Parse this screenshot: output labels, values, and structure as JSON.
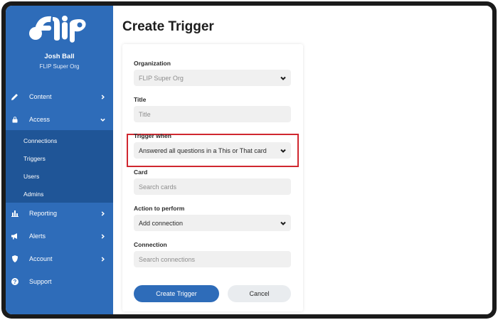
{
  "user": {
    "name": "Josh Ball",
    "org": "FLIP Super Org"
  },
  "logo_text": "FLIP",
  "nav": {
    "content": "Content",
    "access": "Access",
    "access_sub": [
      "Connections",
      "Triggers",
      "Users",
      "Admins"
    ],
    "reporting": "Reporting",
    "alerts": "Alerts",
    "account": "Account",
    "support": "Support"
  },
  "page": {
    "title": "Create Trigger"
  },
  "form": {
    "organization": {
      "label": "Organization",
      "value": "FLIP Super Org"
    },
    "title": {
      "label": "Title",
      "placeholder": "Title"
    },
    "trigger_when": {
      "label": "Trigger when",
      "value": "Answered all questions in a This or That card"
    },
    "card": {
      "label": "Card",
      "placeholder": "Search cards"
    },
    "action": {
      "label": "Action to perform",
      "value": "Add connection"
    },
    "connection": {
      "label": "Connection",
      "placeholder": "Search connections"
    },
    "submit_label": "Create Trigger",
    "cancel_label": "Cancel"
  },
  "colors": {
    "sidebar": "#2e6cb9",
    "sidebar_active": "#1f5597",
    "primary": "#2e6cb9",
    "highlight": "#d0272f"
  }
}
